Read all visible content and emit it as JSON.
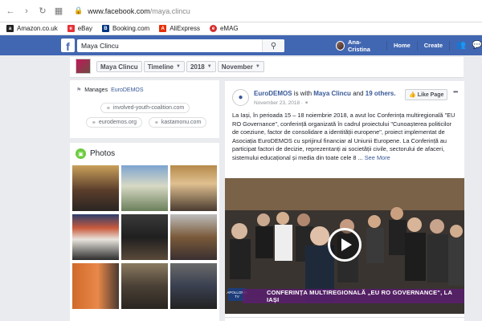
{
  "browser": {
    "url_host": "www.facebook.com",
    "url_path": "/maya.clincu",
    "bookmarks": [
      {
        "label": "Amazon.co.uk",
        "color": "#222222"
      },
      {
        "label": "eBay",
        "color": "#e53238"
      },
      {
        "label": "Booking.com",
        "color": "#003580"
      },
      {
        "label": "AliExpress",
        "color": "#e62e04"
      },
      {
        "label": "eMAG",
        "color": "#d32f2f"
      }
    ]
  },
  "fb_header": {
    "logo": "f",
    "search_value": "Maya Clincu",
    "user_name": "Ana-Cristina",
    "home_label": "Home",
    "create_label": "Create",
    "brand_color": "#4267b2"
  },
  "timeline_nav": {
    "crumbs": [
      "Maya Clincu",
      "Timeline",
      "2018",
      "November"
    ]
  },
  "manages": {
    "label": "Manages",
    "page": "EuroDEMOS",
    "links": [
      "involved-youth-coalition.com",
      "eurodemos.org",
      "kastamonu.com"
    ]
  },
  "photos": {
    "title": "Photos"
  },
  "post": {
    "page_name": "EuroDEMOS",
    "with_text": "is with",
    "tagged_person": "Maya Clincu",
    "and_text": "and",
    "others": "19 others.",
    "date": "November 23, 2018 · ",
    "like_label": "Like Page",
    "body": "La Iași, în perioada 15 – 18 noiembrie 2018, a avut loc Conferința multiregională \"EU RO Governance\", conferință organizată în cadrul proiectului \"Cunoașterea politicilor de coeziune, factor de consolidare a identității europene\", proiect implementat de Asociația EuroDEMOS cu sprijinul financiar al Uniunii Europene. La Conferință au participat factori de decizie, reprezentanți ai societății civile, sectorului de afaceri, sistemului educațional și media din toate cele 8 ... ",
    "see_more": "See More",
    "video_caption": "CONFERINȚA MULTIREGIONALĂ „EU RO GOVERNANCE\", LA IAȘI",
    "tv_logo": "APOLLONIA TV"
  }
}
